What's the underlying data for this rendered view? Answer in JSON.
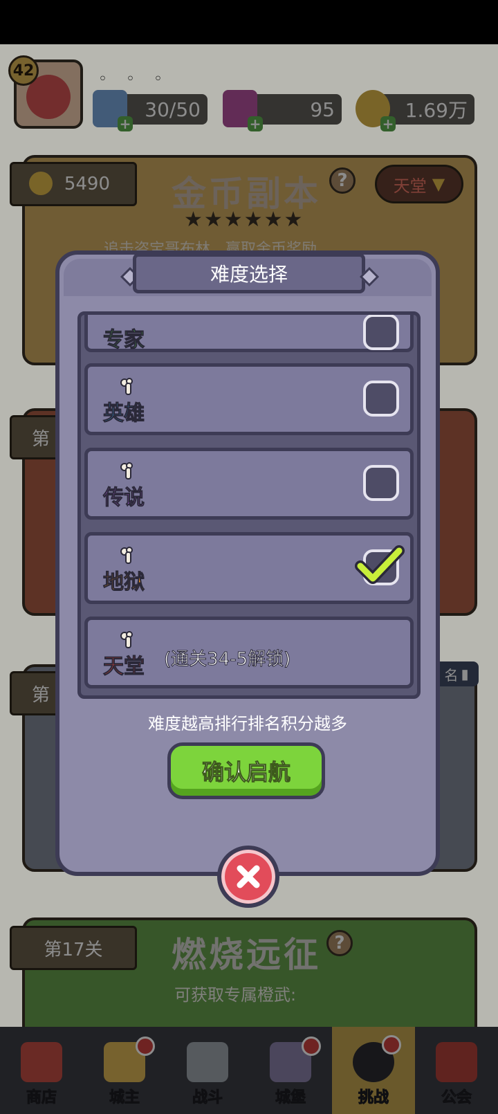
{
  "top_bar": {
    "level": "42",
    "dots": "◦ ◦ ◦",
    "energy": "30/50",
    "gems": "95",
    "coins": "1.69万"
  },
  "background": {
    "gold_dungeon": {
      "coin_count": "5490",
      "title": "金币副本",
      "difficulty_selected": "天堂",
      "subtitle": "追击盗宝哥布林，赢取金币奖励"
    },
    "expedition": {
      "stage": "第17关",
      "title": "燃烧远征",
      "subtitle": "可获取专属橙武:"
    },
    "partial_ribbon_1": "第",
    "partial_ribbon_2": "第",
    "rank_tag": "名"
  },
  "modal": {
    "title": "难度选择",
    "rows": [
      {
        "label": "专家",
        "color": "#57d14a",
        "checked": false
      },
      {
        "label": "英雄",
        "color": "#43b6ff",
        "checked": false
      },
      {
        "label": "传说",
        "color": "#c26cf2",
        "checked": false
      },
      {
        "label": "地狱",
        "color": "#ff9a1e",
        "checked": true
      },
      {
        "label": "天堂",
        "color": "#ff4c3a",
        "locked_note": "(通关34-5解锁)"
      }
    ],
    "hint": "难度越高排行排名积分越多",
    "confirm_label": "确认启航",
    "close_icon": "close-x-icon"
  },
  "bottom_nav": [
    {
      "label": "商店",
      "icon": "shop-icon",
      "badge": false
    },
    {
      "label": "城主",
      "icon": "crown-icon",
      "badge": true
    },
    {
      "label": "战斗",
      "icon": "swords-icon",
      "badge": false
    },
    {
      "label": "城堡",
      "icon": "castle-icon",
      "badge": true
    },
    {
      "label": "挑战",
      "icon": "demon-icon",
      "badge": true,
      "active": true
    },
    {
      "label": "公会",
      "icon": "guild-banner-icon",
      "badge": false
    }
  ]
}
